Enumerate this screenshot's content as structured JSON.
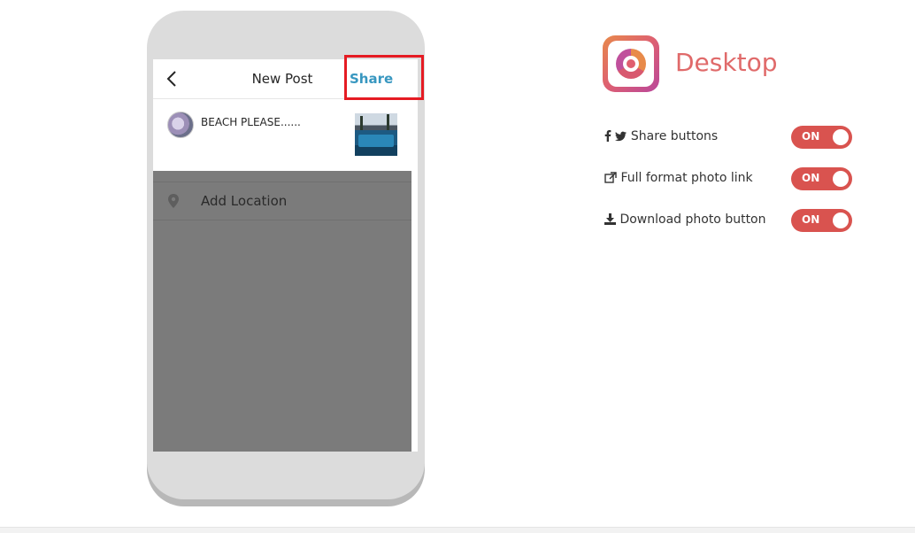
{
  "phone": {
    "header": {
      "title": "New Post",
      "share_label": "Share"
    },
    "post": {
      "caption": "BEACH PLEASE......"
    },
    "location": {
      "label": "Add Location"
    }
  },
  "panel": {
    "brand": "Desktop",
    "settings": [
      {
        "label": "Share buttons",
        "icons": [
          "facebook-icon",
          "twitter-icon"
        ],
        "toggle": "ON"
      },
      {
        "label": "Full format photo link",
        "icons": [
          "external-link-icon"
        ],
        "toggle": "ON"
      },
      {
        "label": "Download photo button",
        "icons": [
          "download-icon"
        ],
        "toggle": "ON"
      }
    ]
  },
  "colors": {
    "share_blue": "#3897c0",
    "highlight_red": "#e51b23",
    "toggle_on": "#d9534f",
    "brand_text": "#e06a6a",
    "overlay_gray": "#7b7b7b"
  }
}
